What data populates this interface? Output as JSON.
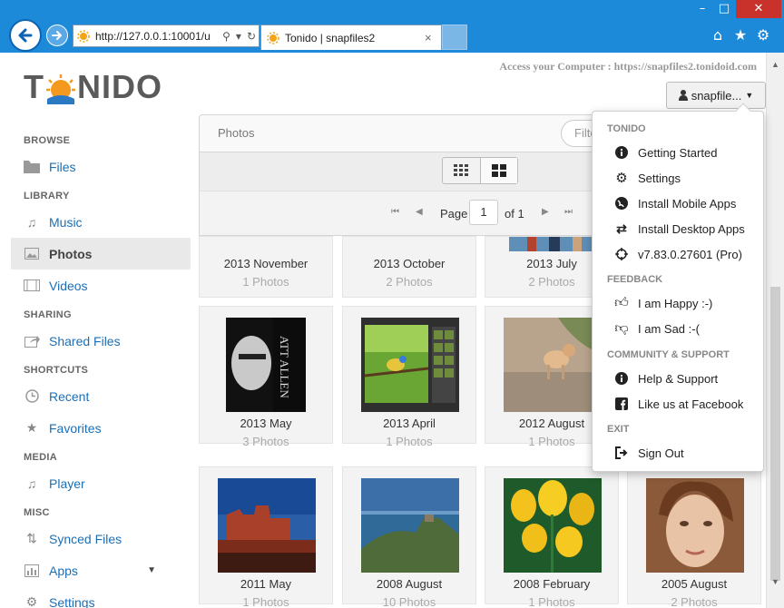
{
  "browser": {
    "url": "http://127.0.0.1:10001/u",
    "tab_title": "Tonido | snapfiles2",
    "close_tab": "×",
    "win_min": "–",
    "win_max": "□",
    "win_close": "✕"
  },
  "header": {
    "logo_left": "T",
    "logo_right": "NIDO",
    "access_text": "Access your Computer : https://snapfiles2.tonidoid.com",
    "user_label": "snapfile..."
  },
  "sidebar": {
    "sections": [
      "BROWSE",
      "LIBRARY",
      "SHARING",
      "SHORTCUTS",
      "MEDIA",
      "MISC"
    ],
    "items": {
      "files": "Files",
      "music": "Music",
      "photos": "Photos",
      "videos": "Videos",
      "shared": "Shared Files",
      "recent": "Recent",
      "favorites": "Favorites",
      "player": "Player",
      "synced": "Synced Files",
      "apps": "Apps",
      "settings": "Settings"
    }
  },
  "main": {
    "breadcrumb": "Photos",
    "filter_placeholder": "Filte",
    "pager": {
      "page_label": "Page",
      "page_value": "1",
      "of_label": "of 1"
    }
  },
  "tiles": [
    {
      "name": "2013 November",
      "count": "1 Photos"
    },
    {
      "name": "2013 October",
      "count": "2 Photos"
    },
    {
      "name": "2013 July",
      "count": "2 Photos"
    },
    {
      "name": "2013 May",
      "count": "3 Photos"
    },
    {
      "name": "2013 April",
      "count": "1 Photos"
    },
    {
      "name": "2012 August",
      "count": "1 Photos"
    },
    {
      "name": "2011 May",
      "count": "1 Photos"
    },
    {
      "name": "2008 August",
      "count": "10 Photos"
    },
    {
      "name": "2008 February",
      "count": "1 Photos"
    },
    {
      "name": "2005 August",
      "count": "2 Photos"
    }
  ],
  "menu": {
    "sections": [
      "TONIDO",
      "FEEDBACK",
      "COMMUNITY & SUPPORT",
      "EXIT"
    ],
    "items": {
      "getting_started": "Getting Started",
      "settings": "Settings",
      "mobile": "Install Mobile Apps",
      "desktop": "Install Desktop Apps",
      "version": "v7.83.0.27601 (Pro)",
      "happy": "I am Happy :-)",
      "sad": "I am Sad :-(",
      "help": "Help & Support",
      "facebook": "Like us at Facebook",
      "signout": "Sign Out"
    }
  },
  "colors": {
    "chrome": "#1c8ad9",
    "link": "#1b6fb5",
    "close": "#c9312b"
  }
}
